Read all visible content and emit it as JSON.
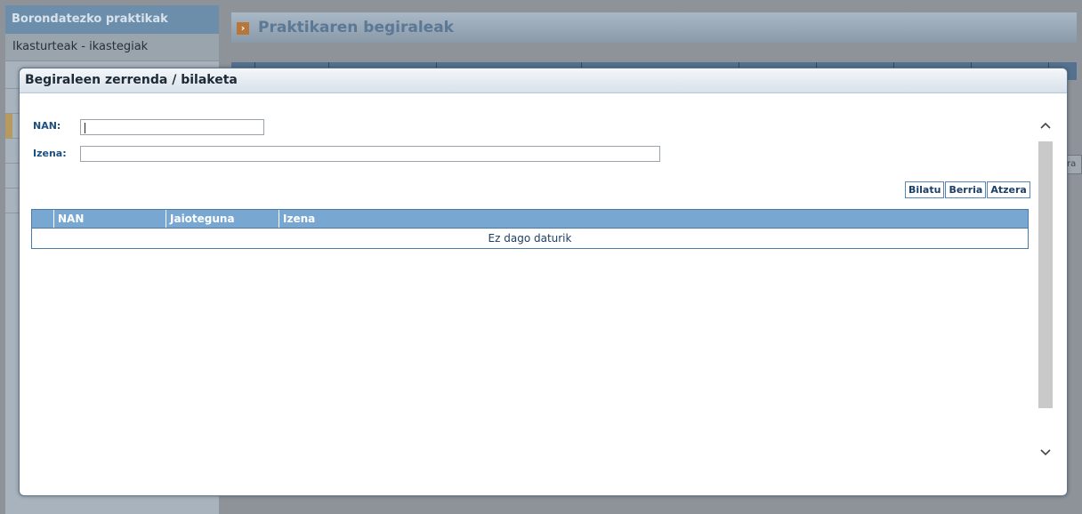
{
  "background": {
    "sidebar": {
      "section_title": "Borondatezko praktikak",
      "item": "Ikasturteak - ikastegiak"
    },
    "page_title": "Praktikaren begiraleak",
    "partial_button": "ra"
  },
  "modal": {
    "title": "Begiraleen zerrenda / bilaketa",
    "form": {
      "nan_label": "NAN:",
      "nan_value": "",
      "izena_label": "Izena:",
      "izena_value": ""
    },
    "buttons": {
      "search": "Bilatu",
      "new": "Berria",
      "back": "Atzera"
    },
    "table": {
      "columns": [
        "",
        "NAN",
        "Jaioteguna",
        "Izena"
      ],
      "empty_message": "Ez dago daturik"
    }
  }
}
